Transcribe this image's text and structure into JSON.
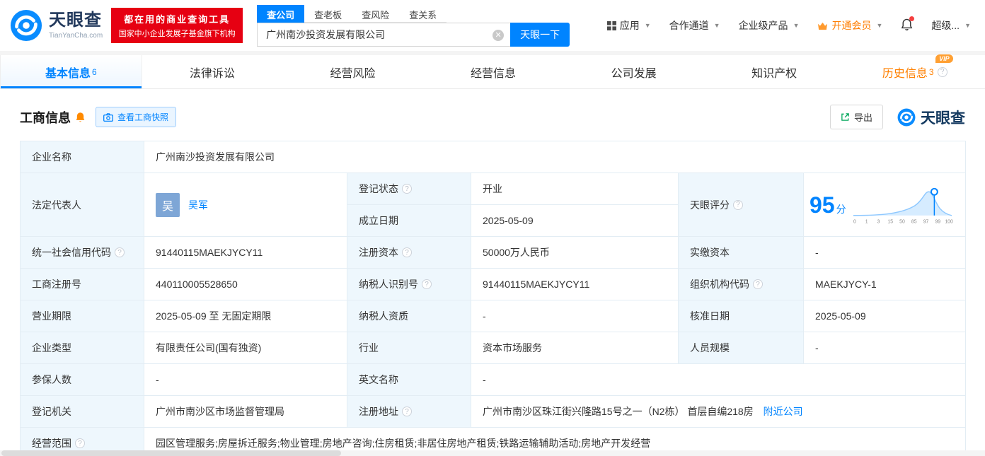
{
  "header": {
    "logo": {
      "brand": "天眼查",
      "domain": "TianYanCha.com"
    },
    "badge": {
      "line1": "都在用的商业查询工具",
      "line2": "国家中小企业发展子基金旗下机构"
    },
    "search_tabs": [
      {
        "label": "查公司"
      },
      {
        "label": "查老板"
      },
      {
        "label": "查风险"
      },
      {
        "label": "查关系"
      }
    ],
    "search": {
      "value": "广州南沙投资发展有限公司",
      "button": "天眼一下"
    },
    "nav": {
      "apps": "应用",
      "partners": "合作通道",
      "enterprise": "企业级产品",
      "vip": "开通会员",
      "super": "超级..."
    }
  },
  "tabs": {
    "basic": {
      "label": "基本信息",
      "count": "6"
    },
    "legal": {
      "label": "法律诉讼"
    },
    "risk": {
      "label": "经营风险"
    },
    "operation": {
      "label": "经营信息"
    },
    "development": {
      "label": "公司发展"
    },
    "ip": {
      "label": "知识产权"
    },
    "history": {
      "label": "历史信息",
      "count": "3",
      "vip_tag": "VIP"
    }
  },
  "section": {
    "title": "工商信息",
    "snapshot_button": "查看工商快照",
    "export_button": "导出",
    "logo": "天眼查"
  },
  "fields": {
    "company_name": {
      "label": "企业名称",
      "value": "广州南沙投资发展有限公司"
    },
    "legal_rep": {
      "label": "法定代表人",
      "avatar": "吴",
      "value": "吴军"
    },
    "reg_status": {
      "label": "登记状态",
      "value": "开业"
    },
    "establish_date": {
      "label": "成立日期",
      "value": "2025-05-09"
    },
    "score": {
      "label": "天眼评分",
      "value": "95",
      "unit": "分"
    },
    "credit_code": {
      "label": "统一社会信用代码",
      "value": "91440115MAEKJYCY11"
    },
    "reg_capital": {
      "label": "注册资本",
      "value": "50000万人民币"
    },
    "paid_capital": {
      "label": "实缴资本",
      "value": "-"
    },
    "reg_number": {
      "label": "工商注册号",
      "value": "440110005528650"
    },
    "taxpayer_id": {
      "label": "纳税人识别号",
      "value": "91440115MAEKJYCY11"
    },
    "org_code": {
      "label": "组织机构代码",
      "value": "MAEKJYCY-1"
    },
    "business_term": {
      "label": "营业期限",
      "value": "2025-05-09 至 无固定期限"
    },
    "taxpayer_quality": {
      "label": "纳税人资质",
      "value": "-"
    },
    "approval_date": {
      "label": "核准日期",
      "value": "2025-05-09"
    },
    "company_type": {
      "label": "企业类型",
      "value": "有限责任公司(国有独资)"
    },
    "industry": {
      "label": "行业",
      "value": "资本市场服务"
    },
    "staff_size": {
      "label": "人员规模",
      "value": "-"
    },
    "insured_count": {
      "label": "参保人数",
      "value": "-"
    },
    "english_name": {
      "label": "英文名称",
      "value": "-"
    },
    "reg_authority": {
      "label": "登记机关",
      "value": "广州市南沙区市场监督管理局"
    },
    "reg_address": {
      "label": "注册地址",
      "value": "广州市南沙区珠江街兴隆路15号之一（N2栋） 首层自编218房",
      "link": "附近公司"
    },
    "business_scope": {
      "label": "经营范围",
      "value": "园区管理服务;房屋拆迁服务;物业管理;房地产咨询;住房租赁;非居住房地产租赁;铁路运输辅助活动;房地产开发经营"
    }
  },
  "chart_data": {
    "type": "area",
    "title": "天眼评分",
    "score": 95,
    "unit": "分",
    "xticks": [
      "0",
      "1",
      "3",
      "15",
      "50",
      "85",
      "97",
      "99",
      "100"
    ],
    "marker_score": 95,
    "curve_color": "#8ec8ff",
    "fill_color": "#d6ecff"
  }
}
